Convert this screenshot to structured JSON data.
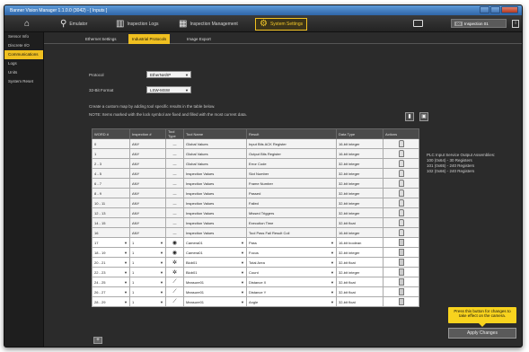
{
  "window": {
    "title": "Banner Vision Manager 1.1.0.0 (3042) - [ Inputs ]"
  },
  "nav": {
    "items": [
      {
        "id": "home",
        "label": "",
        "icon": "home-icon"
      },
      {
        "id": "emulator",
        "label": "Emulator",
        "icon": "search-icon"
      },
      {
        "id": "logs",
        "label": "Inspection Logs",
        "icon": "bars-icon"
      },
      {
        "id": "mgmt",
        "label": "Inspection Management",
        "icon": "grid-icon"
      },
      {
        "id": "settings",
        "label": "System Settings",
        "icon": "gear-icon"
      }
    ],
    "inspection_select": {
      "badge": "00",
      "value": "Inspection 01"
    },
    "info_label": "i"
  },
  "sidebar": {
    "items": [
      {
        "label": "Sensor Info"
      },
      {
        "label": "Discrete I/O"
      },
      {
        "label": "Communications"
      },
      {
        "label": "Logs"
      },
      {
        "label": "Units"
      },
      {
        "label": "System Reset"
      }
    ]
  },
  "subtabs": [
    "Ethernet Settings",
    "Industrial Protocols",
    "Image Export"
  ],
  "form": {
    "protocol_label": "Protocol",
    "protocol_value": "EtherNet/IP",
    "format_label": "32-Bit Format",
    "format_value": "LSW-MSW"
  },
  "desc": {
    "line1": "Create a custom map by adding tool specific results in the table below.",
    "line2": "NOTE: Items marked with the lock symbol are fixed and filled with the most current data."
  },
  "tools": {
    "delete_icon": "trash-icon",
    "save_icon": "save-icon"
  },
  "table": {
    "headers": [
      "WORD #",
      "Inspection #",
      "Tool Type",
      "Tool Name",
      "Result",
      "Data Type",
      "Actions"
    ],
    "rows": [
      {
        "word": "0",
        "insp": "ANY",
        "type": "—",
        "name": "Global Values",
        "result": "Input Bits ACK Register",
        "dtype": "16-bit integer",
        "action": "lock",
        "editable": false
      },
      {
        "word": "1",
        "insp": "ANY",
        "type": "—",
        "name": "Global Values",
        "result": "Output Bits Register",
        "dtype": "16-bit integer",
        "action": "lock",
        "editable": false
      },
      {
        "word": "2 - 3",
        "insp": "ANY",
        "type": "—",
        "name": "Global Values",
        "result": "Error Code",
        "dtype": "32-bit integer",
        "action": "lock",
        "editable": false
      },
      {
        "word": "4 - 5",
        "insp": "ANY",
        "type": "—",
        "name": "Inspection Values",
        "result": "Slot Number",
        "dtype": "32-bit integer",
        "action": "lock",
        "editable": false
      },
      {
        "word": "6 - 7",
        "insp": "ANY",
        "type": "—",
        "name": "Inspection Values",
        "result": "Frame Number",
        "dtype": "32-bit integer",
        "action": "lock",
        "editable": false
      },
      {
        "word": "8 - 9",
        "insp": "ANY",
        "type": "—",
        "name": "Inspection Values",
        "result": "Passed",
        "dtype": "32-bit integer",
        "action": "lock",
        "editable": false
      },
      {
        "word": "10 - 11",
        "insp": "ANY",
        "type": "—",
        "name": "Inspection Values",
        "result": "Failed",
        "dtype": "32-bit integer",
        "action": "lock",
        "editable": false
      },
      {
        "word": "12 - 13",
        "insp": "ANY",
        "type": "—",
        "name": "Inspection Values",
        "result": "Missed Triggers",
        "dtype": "32-bit integer",
        "action": "lock",
        "editable": false
      },
      {
        "word": "14 - 15",
        "insp": "ANY",
        "type": "—",
        "name": "Inspection Values",
        "result": "Execution Time",
        "dtype": "32-bit float",
        "action": "lock",
        "editable": false
      },
      {
        "word": "16",
        "insp": "ANY",
        "type": "—",
        "name": "Inspection Values",
        "result": "Tool Pass Fail Result Coil",
        "dtype": "16-bit integer",
        "action": "lock",
        "editable": false
      },
      {
        "word": "17",
        "insp": "1",
        "type": "camera",
        "name": "Camera01",
        "result": "Pass",
        "dtype": "16-bit boolean",
        "action": "trash",
        "editable": true
      },
      {
        "word": "18 - 19",
        "insp": "1",
        "type": "camera",
        "name": "Camera01",
        "result": "Focus",
        "dtype": "32-bit integer",
        "action": "trash",
        "editable": true
      },
      {
        "word": "20 - 21",
        "insp": "1",
        "type": "blob",
        "name": "Blob01",
        "result": "Total Area",
        "dtype": "32-bit float",
        "action": "trash",
        "editable": true
      },
      {
        "word": "22 - 23",
        "insp": "1",
        "type": "blob",
        "name": "Blob01",
        "result": "Count",
        "dtype": "32-bit integer",
        "action": "trash",
        "editable": true
      },
      {
        "word": "24 - 25",
        "insp": "1",
        "type": "measure",
        "name": "Measure01",
        "result": "Distance X",
        "dtype": "32-bit float",
        "action": "trash",
        "editable": true
      },
      {
        "word": "26 - 27",
        "insp": "1",
        "type": "measure",
        "name": "Measure01",
        "result": "Distance Y",
        "dtype": "32-bit float",
        "action": "trash",
        "editable": true
      },
      {
        "word": "28 - 29",
        "insp": "1",
        "type": "measure",
        "name": "Measure01",
        "result": "Angle",
        "dtype": "32-bit float",
        "action": "trash",
        "editable": true
      }
    ]
  },
  "add_row_label": "+",
  "note": {
    "line1": "PLC Input Service Output Assemblies:",
    "line2": "100 (0x64) - 30 Registers",
    "line3": "101 (0x65) - 240 Registers",
    "line4": "102 (0x66) - 240 Registers"
  },
  "tooltip": "Press this button for changes to take effect on the camera.",
  "apply_label": "Apply Changes",
  "colors": {
    "accent": "#f0c020",
    "titlebar": "#2f66a8"
  }
}
